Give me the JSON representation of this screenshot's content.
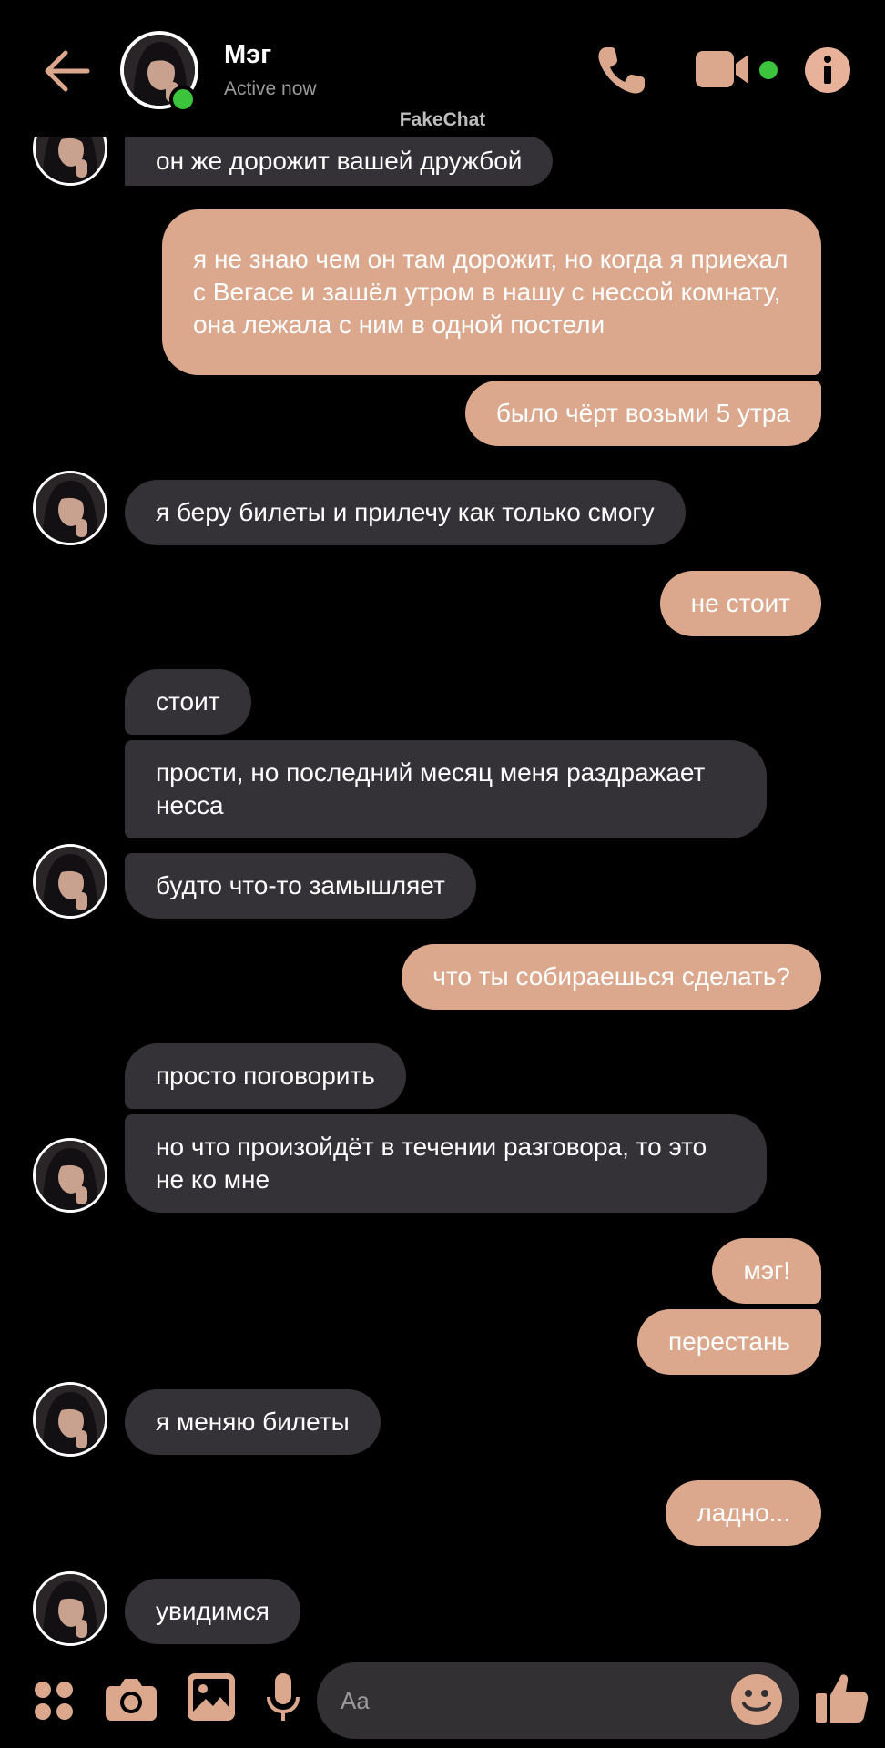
{
  "header": {
    "name": "Мэг",
    "status": "Active now",
    "watermark": "FakeChat"
  },
  "colors": {
    "accent": "#dba88d",
    "incoming_bubble": "#343236",
    "online": "#3cc43c",
    "background": "#000000"
  },
  "messages": [
    {
      "dir": "in",
      "text": "он же дорожит вашей дружбой"
    },
    {
      "dir": "out",
      "text": "я не знаю чем он там дорожит,  но когда я приехал с Вегасе и зашёл утром в нашу с нессой комнату, она лежала с ним в одной постели"
    },
    {
      "dir": "out",
      "text": "было чёрт возьми 5 утра"
    },
    {
      "dir": "in",
      "text": "я беру билеты и прилечу как только смогу"
    },
    {
      "dir": "out",
      "text": "не стоит"
    },
    {
      "dir": "in",
      "text": "стоит"
    },
    {
      "dir": "in",
      "text": "прости, но последний месяц меня раздражает несса"
    },
    {
      "dir": "in",
      "text": "будто что-то замышляет"
    },
    {
      "dir": "out",
      "text": "что ты собираешься сделать?"
    },
    {
      "dir": "in",
      "text": "просто поговорить"
    },
    {
      "dir": "in",
      "text": "но что произойдёт в течении разговора, то это не ко мне"
    },
    {
      "dir": "out",
      "text": "мэг!"
    },
    {
      "dir": "out",
      "text": "перестань"
    },
    {
      "dir": "in",
      "text": "я меняю билеты"
    },
    {
      "dir": "out",
      "text": "ладно..."
    },
    {
      "dir": "in",
      "text": "увидимся"
    }
  ],
  "composer": {
    "placeholder": "Aa"
  },
  "icons": [
    "back-arrow-icon",
    "phone-icon",
    "video-camera-icon",
    "info-icon",
    "apps-grid-icon",
    "camera-icon",
    "image-icon",
    "microphone-icon",
    "emoji-icon",
    "thumbs-up-icon"
  ]
}
